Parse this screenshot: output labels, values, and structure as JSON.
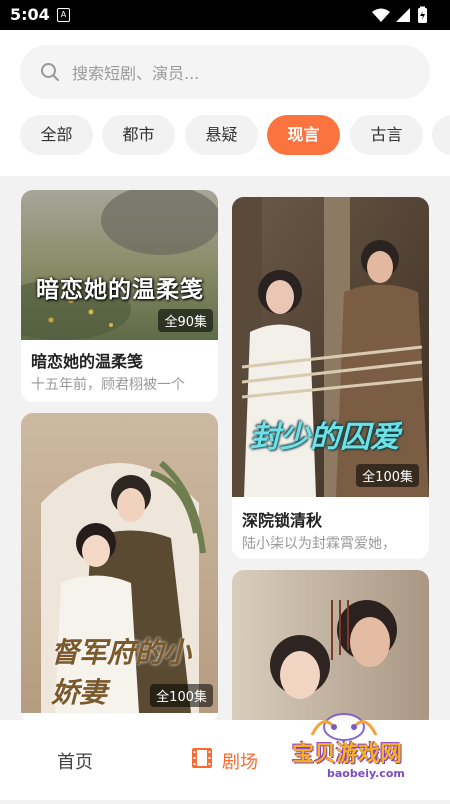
{
  "status_bar": {
    "time": "5:04",
    "notification_glyph": "A"
  },
  "search": {
    "placeholder": "搜索短剧、演员..."
  },
  "tabs": [
    {
      "label": "全部",
      "active": false
    },
    {
      "label": "都市",
      "active": false
    },
    {
      "label": "悬疑",
      "active": false
    },
    {
      "label": "现言",
      "active": true
    },
    {
      "label": "古言",
      "active": false
    }
  ],
  "cards": [
    {
      "poster_text": "暗恋她的温柔笺",
      "badge": "全90集",
      "title": "暗恋她的温柔笺",
      "desc": "十五年前，顾君栩被一个"
    },
    {
      "poster_text": "封少的囚爱",
      "badge": "全100集",
      "title": "深院锁清秋",
      "desc": "陆小柒以为封霖霄爱她，"
    },
    {
      "poster_text": "督军府的小娇妻",
      "badge": "全100集",
      "title": "",
      "desc": ""
    },
    {
      "poster_text": "",
      "badge": "",
      "title": "",
      "desc": ""
    }
  ],
  "bottom_nav": {
    "home": "首页",
    "theater": "剧场"
  },
  "watermark": {
    "cn": "宝贝游戏网",
    "url": "baobeiy.com"
  },
  "colors": {
    "accent": "#fb7440",
    "background": "#f2f2f2"
  }
}
